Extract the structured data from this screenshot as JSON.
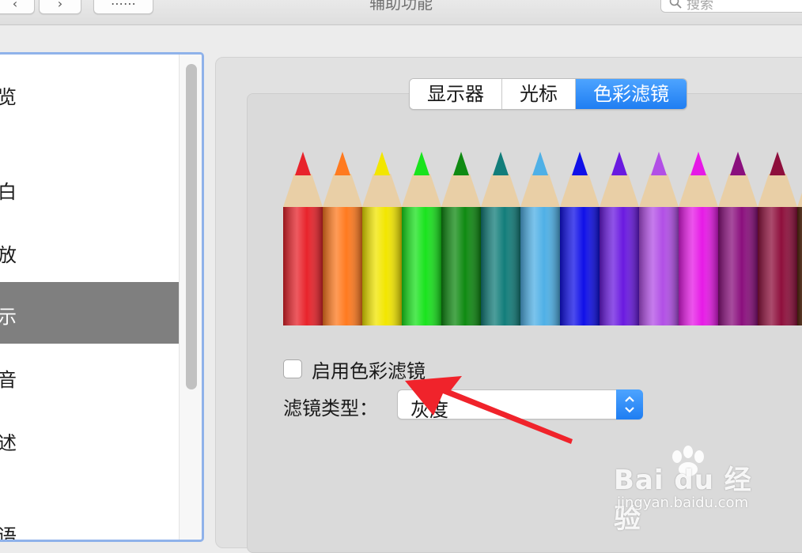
{
  "window": {
    "title": "辅助功能",
    "search_placeholder": "搜索"
  },
  "toolbar": {
    "back_icon": "chevron-left-icon",
    "forward_icon": "chevron-right-icon",
    "grid_icon": "grid-icon"
  },
  "sidebar": {
    "items": [
      {
        "label": "览"
      },
      {
        "label": "白"
      },
      {
        "label": "放"
      },
      {
        "label": "示",
        "selected": true
      },
      {
        "label": "音"
      },
      {
        "label": "述"
      },
      {
        "label": "语"
      }
    ]
  },
  "tabs": [
    {
      "label": "显示器",
      "active": false
    },
    {
      "label": "光标",
      "active": false
    },
    {
      "label": "色彩滤镜",
      "active": true
    }
  ],
  "pencil_colors": [
    "#e8232b",
    "#ff7a1f",
    "#f2e600",
    "#19e31d",
    "#0f8a12",
    "#127d7a",
    "#4fb0e6",
    "#1010e8",
    "#6a1ae0",
    "#b24fe6",
    "#e61ae6",
    "#8a0f7d",
    "#8e0f3c",
    "#5a2a10"
  ],
  "filter": {
    "enable_label": "启用色彩滤镜",
    "enabled": false,
    "type_label": "滤镜类型：",
    "type_value": "灰度"
  },
  "watermark": {
    "brand": "Bai du 经验",
    "url": "jingyan.baidu.com"
  },
  "colors": {
    "accent": "#1f7ef2",
    "sidebar_selected": "#7f7f7f",
    "sidebar_focus_ring": "#8fb2ea",
    "annotation_arrow": "#f0232b"
  }
}
